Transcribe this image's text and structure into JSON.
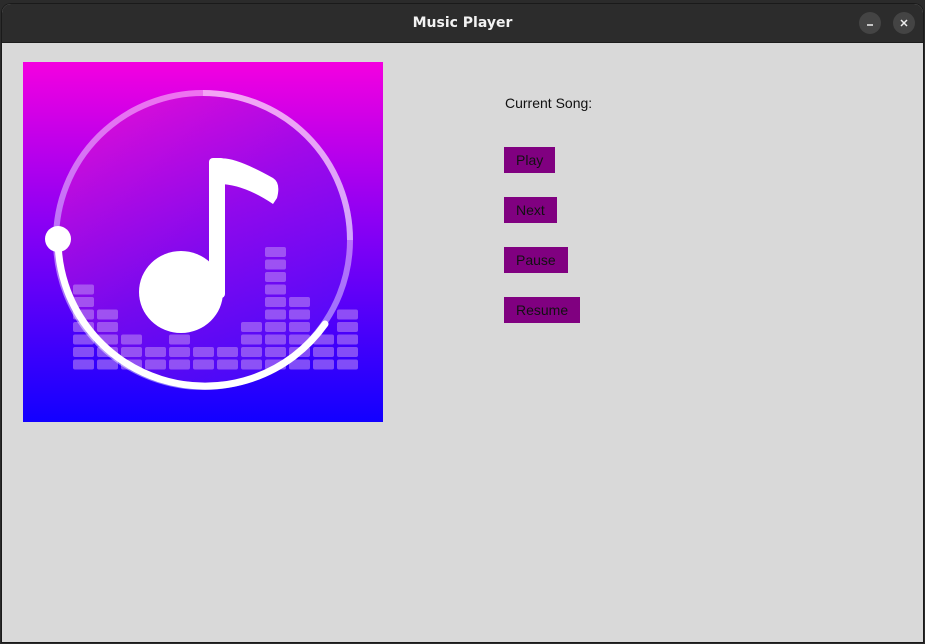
{
  "window": {
    "title": "Music Player",
    "minimize_icon": "minimize-icon",
    "close_icon": "close-icon"
  },
  "player": {
    "current_song_label": "Current Song:",
    "album_art_icon": "music-note-icon",
    "buttons": {
      "play": "Play",
      "next": "Next",
      "pause": "Pause",
      "resume": "Resume"
    }
  },
  "colors": {
    "button_bg": "#800080",
    "window_bg": "#d9d9d9",
    "titlebar_bg": "#2c2c2c",
    "art_gradient_top": "#ff00dd",
    "art_gradient_bottom": "#1400ff"
  }
}
